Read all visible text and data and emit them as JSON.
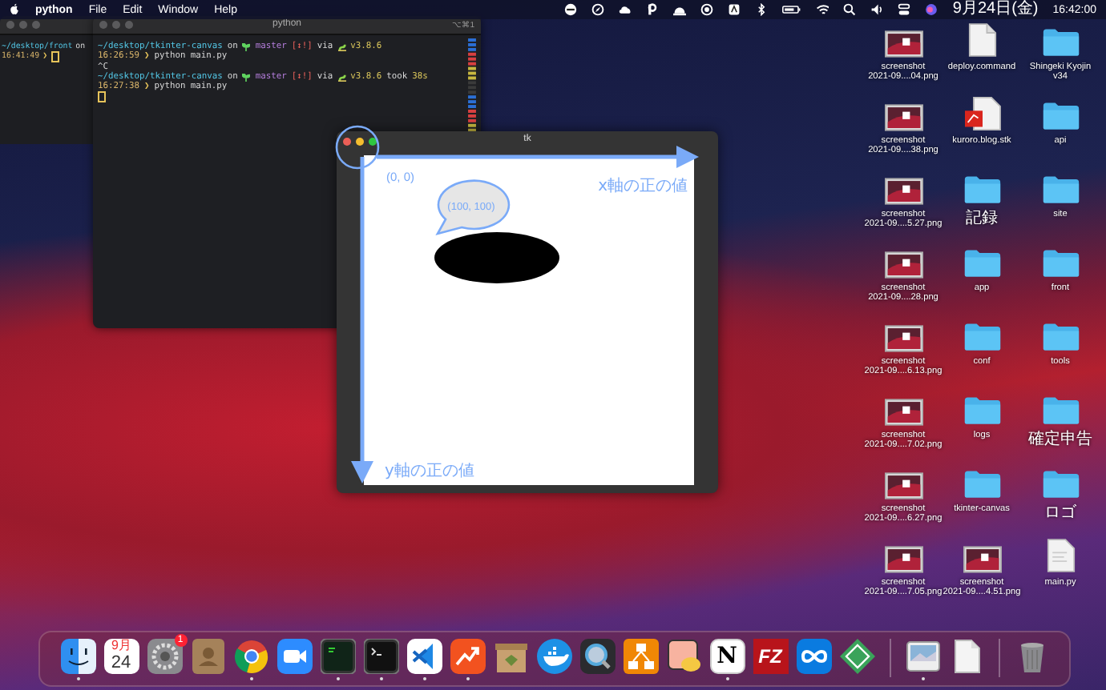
{
  "menu_bar": {
    "app_name": "python",
    "menus": [
      "File",
      "Edit",
      "Window",
      "Help"
    ],
    "date": "9月24日(金)",
    "time": "16:42:00"
  },
  "terminal_back": {
    "lines": [
      [
        {
          "kind": "path",
          "text": "~/desktop/front"
        },
        {
          "kind": "plain",
          "text": "on"
        }
      ],
      [
        {
          "kind": "time",
          "text": "16:41:49"
        },
        {
          "kind": "prompt",
          "text": "❯"
        },
        {
          "kind": "cursor"
        }
      ]
    ]
  },
  "terminal": {
    "title": "python",
    "shortcut": "⌥⌘1",
    "lines": [
      [
        {
          "kind": "path",
          "text": "~/desktop/tkinter-canvas"
        },
        {
          "kind": "plain",
          "text": "on"
        },
        {
          "kind": "sprout"
        },
        {
          "kind": "branch",
          "text": "master"
        },
        {
          "kind": "status",
          "text": "[↕!]"
        },
        {
          "kind": "plain",
          "text": "via"
        },
        {
          "kind": "snake"
        },
        {
          "kind": "version",
          "text": "v3.8.6"
        }
      ],
      [
        {
          "kind": "time",
          "text": "16:26:59"
        },
        {
          "kind": "prompt",
          "text": "❯"
        },
        {
          "kind": "plain",
          "text": "python main.py"
        }
      ],
      [
        {
          "kind": "plain",
          "text": "^C"
        }
      ],
      [
        {
          "kind": "path",
          "text": "~/desktop/tkinter-canvas"
        },
        {
          "kind": "plain",
          "text": "on"
        },
        {
          "kind": "sprout"
        },
        {
          "kind": "branch",
          "text": "master"
        },
        {
          "kind": "status",
          "text": "[↕!]"
        },
        {
          "kind": "plain",
          "text": "via"
        },
        {
          "kind": "snake"
        },
        {
          "kind": "version",
          "text": "v3.8.6"
        },
        {
          "kind": "plain",
          "text": "took"
        },
        {
          "kind": "version",
          "text": "38s"
        }
      ],
      [
        {
          "kind": "time",
          "text": "16:27:38"
        },
        {
          "kind": "prompt",
          "text": "❯"
        },
        {
          "kind": "plain",
          "text": "python main.py"
        }
      ],
      [
        {
          "kind": "cursor"
        }
      ]
    ]
  },
  "tk_window": {
    "title": "tk",
    "origin_label": "(0, 0)",
    "x_axis_label": "x軸の正の値",
    "bubble_label": "(100, 100)",
    "y_axis_label": "y軸の正の値"
  },
  "desktop_items": [
    {
      "kind": "image",
      "lines": [
        "screenshot",
        "2021-09....04.png"
      ]
    },
    {
      "kind": "script",
      "lines": [
        "deploy.command"
      ]
    },
    {
      "kind": "folder",
      "lines": [
        "Shingeki Kyojin",
        "v34"
      ]
    },
    {
      "kind": "image",
      "lines": [
        "screenshot",
        "2021-09....38.png"
      ]
    },
    {
      "kind": "sitemap",
      "lines": [
        "kuroro.blog.stk"
      ]
    },
    {
      "kind": "folder",
      "lines": [
        "api"
      ]
    },
    {
      "kind": "image",
      "lines": [
        "screenshot",
        "2021-09....5.27.png"
      ]
    },
    {
      "kind": "folder",
      "lines": [
        "記録"
      ]
    },
    {
      "kind": "folder",
      "lines": [
        "site"
      ]
    },
    {
      "kind": "image",
      "lines": [
        "screenshot",
        "2021-09....28.png"
      ]
    },
    {
      "kind": "folder",
      "lines": [
        "app"
      ]
    },
    {
      "kind": "folder",
      "lines": [
        "front"
      ]
    },
    {
      "kind": "image",
      "lines": [
        "screenshot",
        "2021-09....6.13.png"
      ]
    },
    {
      "kind": "folder",
      "lines": [
        "conf"
      ]
    },
    {
      "kind": "folder",
      "lines": [
        "tools"
      ]
    },
    {
      "kind": "image",
      "lines": [
        "screenshot",
        "2021-09....7.02.png"
      ]
    },
    {
      "kind": "folder",
      "lines": [
        "logs"
      ]
    },
    {
      "kind": "folder",
      "lines": [
        "確定申告"
      ]
    },
    {
      "kind": "image",
      "lines": [
        "screenshot",
        "2021-09....6.27.png"
      ]
    },
    {
      "kind": "folder",
      "lines": [
        "tkinter-canvas"
      ]
    },
    {
      "kind": "folder",
      "lines": [
        "ロゴ"
      ]
    },
    {
      "kind": "image",
      "lines": [
        "screenshot",
        "2021-09....7.05.png"
      ]
    },
    {
      "kind": "image",
      "lines": [
        "screenshot",
        "2021-09....4.51.png"
      ]
    },
    {
      "kind": "python",
      "lines": [
        "main.py"
      ]
    }
  ],
  "dock": {
    "apps": [
      {
        "kind": "finder",
        "running": true
      },
      {
        "kind": "calendar",
        "month": "9月",
        "day": "24",
        "running": false
      },
      {
        "kind": "settings",
        "badge": "1",
        "running": false
      },
      {
        "kind": "contacts",
        "running": false
      },
      {
        "kind": "browser",
        "running": true
      },
      {
        "kind": "video",
        "running": false
      },
      {
        "kind": "terminal",
        "running": true
      },
      {
        "kind": "console",
        "running": true
      },
      {
        "kind": "editor",
        "running": true
      },
      {
        "kind": "chart",
        "running": true
      },
      {
        "kind": "archive",
        "running": false
      },
      {
        "kind": "whale",
        "running": false
      },
      {
        "kind": "player",
        "running": false
      },
      {
        "kind": "diagram",
        "running": false
      },
      {
        "kind": "preview",
        "running": false
      },
      {
        "kind": "letter",
        "glyph": "N",
        "running": true
      },
      {
        "kind": "ftp",
        "glyph": "FZ",
        "running": false
      },
      {
        "kind": "infinity",
        "running": false
      },
      {
        "kind": "diamond",
        "running": false
      }
    ],
    "files": [
      {
        "kind": "image",
        "running": true
      },
      {
        "kind": "document",
        "running": false
      }
    ]
  }
}
